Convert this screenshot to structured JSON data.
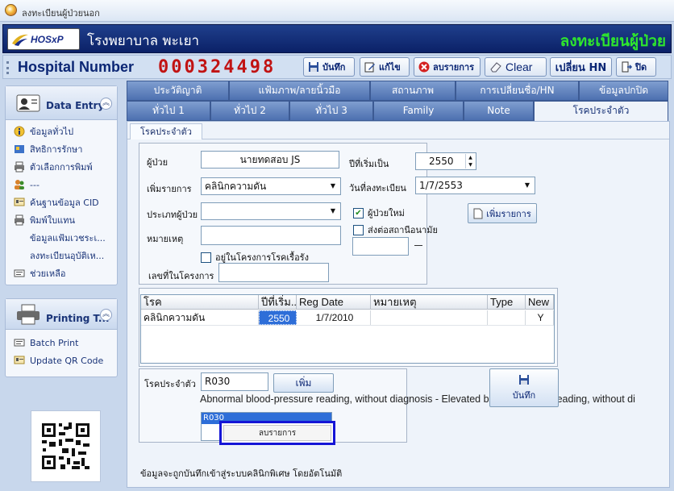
{
  "window": {
    "title": "ลงทะเบียนผู้ป่วยนอก"
  },
  "banner": {
    "logo_text": "HOSxP",
    "hospital_name": "โรงพยาบาล พะเยา",
    "title": "ลงทะเบียนผู้ป่วย"
  },
  "hn_bar": {
    "label": "Hospital Number",
    "value": "000324498",
    "buttons": {
      "save": "บันทึก",
      "edit": "แก้ไข",
      "delete": "ลบรายการ",
      "clear": "Clear",
      "change_hn": "เปลี่ยน HN",
      "close": "ปิด"
    }
  },
  "sidebar": {
    "title": "Data Entry",
    "items": [
      {
        "label": "ข้อมูลทั่วไป",
        "icon": "info-icon"
      },
      {
        "label": "สิทธิการรักษา",
        "icon": "card-icon"
      },
      {
        "label": "ตัวเลือกการพิมพ์",
        "icon": "printer-icon"
      },
      {
        "label": "---",
        "icon": "users-icon"
      },
      {
        "label": "ค้นฐานข้อมูล CID",
        "icon": "id-card-icon"
      },
      {
        "label": "พิมพ์ใบแทน",
        "icon": "printer-icon"
      },
      {
        "label": "ข้อมูลแฟ้มเวชระเ...",
        "icon": ""
      },
      {
        "label": "ลงทะเบียนอุบัติเห...",
        "icon": ""
      },
      {
        "label": "ช่วยเหลือ",
        "icon": "help-icon"
      }
    ]
  },
  "print_panel": {
    "title": "Printing T...",
    "items": [
      {
        "label": "Batch Print"
      },
      {
        "label": "Update QR Code"
      }
    ]
  },
  "tabs_top": [
    {
      "label": "ประวัติญาติ"
    },
    {
      "label": "แฟ้มภาพ/ลายนิ้วมือ"
    },
    {
      "label": "สถานภาพ"
    },
    {
      "label": "การเปลี่ยนชื่อ/HN"
    },
    {
      "label": "ข้อมูลปกปิด"
    }
  ],
  "tabs_bottom": [
    {
      "label": "ทั่วไป 1"
    },
    {
      "label": "ทั่วไป 2"
    },
    {
      "label": "ทั่วไป 3"
    },
    {
      "label": "Family"
    },
    {
      "label": "Note"
    },
    {
      "label": "โรคประจำตัว"
    }
  ],
  "content": {
    "subtab": "โรคประจำตัว",
    "form": {
      "patient_label": "ผู้ป่วย",
      "patient_value": "นายทดสอบ JS",
      "start_year_label": "ปีที่เริ่มเป็น",
      "start_year_value": "2550",
      "add_item_label": "เพิ่มรายการ",
      "add_item_value": "คลินิกความดัน",
      "reg_date_label": "วันที่ลงทะเบียน",
      "reg_date_value": "1/7/2553",
      "patient_type_label": "ประเภทผู้ป่วย",
      "patient_type_value": "",
      "new_patient_label": "ผู้ป่วยใหม่",
      "new_patient_checked": true,
      "refer_label": "ส่งต่อสถานีอนามัย",
      "refer_checked": false,
      "note_label": "หมายเหตุ",
      "chronic_program_label": "อยู่ในโครงการโรคเรื้อรัง",
      "chronic_program_checked": false,
      "program_no_label": "เลขที่ในโครงการ",
      "add_button": "เพิ่มรายการ"
    },
    "grid": {
      "columns": [
        "โรค",
        "ปีที่เริ่ม...",
        "Reg Date",
        "หมายเหตุ",
        "Type",
        "New"
      ],
      "rows": [
        [
          "คลินิกความดัน",
          "2550",
          "1/7/2010",
          "",
          "",
          "Y"
        ]
      ]
    },
    "disease": {
      "label": "โรคประจำตัว",
      "code_value": "R030",
      "add_button": "เพิ่ม",
      "description": "Abnormal blood-pressure reading, without diagnosis - Elevated blood-pressure reading, without di",
      "list_item": "R030"
    },
    "save_button": "บันทึก",
    "context_menu": {
      "item": "ลบรายการ"
    },
    "footer_note": "ข้อมูลจะถูกบันทึกเข้าสู่ระบบคลินิกพิเศษ โดยอัตโนมัติ"
  },
  "colors": {
    "banner": "#0b2167",
    "hn_value": "#c11313",
    "banner_title": "#2ee52e",
    "tab": "#5a7dbd",
    "selection": "#2e6ed8",
    "context_highlight": "#1515d6"
  }
}
